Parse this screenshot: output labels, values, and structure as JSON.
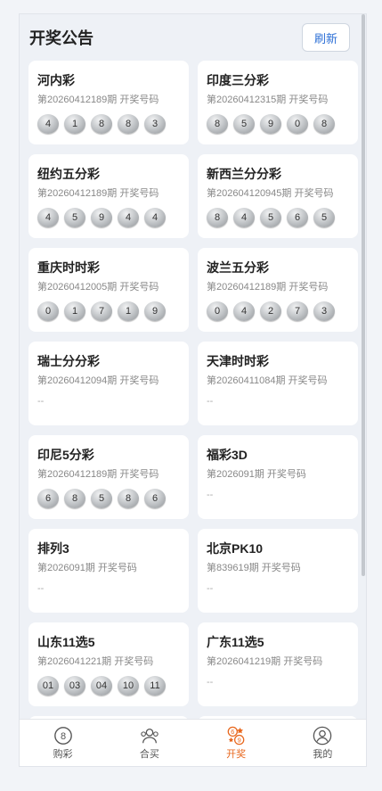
{
  "header": {
    "title": "开奖公告",
    "refresh_label": "刷新"
  },
  "lotteries": [
    {
      "name": "河内彩",
      "issue": "第20260412189期 开奖号码",
      "balls": [
        "4",
        "1",
        "8",
        "8",
        "3"
      ]
    },
    {
      "name": "印度三分彩",
      "issue": "第20260412315期 开奖号码",
      "balls": [
        "8",
        "5",
        "9",
        "0",
        "8"
      ]
    },
    {
      "name": "纽约五分彩",
      "issue": "第20260412189期 开奖号码",
      "balls": [
        "4",
        "5",
        "9",
        "4",
        "4"
      ]
    },
    {
      "name": "新西兰分分彩",
      "issue": "第20260412094​5期 开奖号码",
      "balls": [
        "8",
        "4",
        "5",
        "6",
        "5"
      ]
    },
    {
      "name": "重庆时时彩",
      "issue": "第20260412005期 开奖号码",
      "balls": [
        "0",
        "1",
        "7",
        "1",
        "9"
      ]
    },
    {
      "name": "波兰五分彩",
      "issue": "第20260412189期 开奖号码",
      "balls": [
        "0",
        "4",
        "2",
        "7",
        "3"
      ]
    },
    {
      "name": "瑞士分分彩",
      "issue": "第20260412094期 开奖号码",
      "balls": [],
      "empty": "--"
    },
    {
      "name": "天津时时彩",
      "issue": "第20260411084期 开奖号码",
      "balls": [],
      "empty": "--"
    },
    {
      "name": "印尼5分彩",
      "issue": "第20260412189期 开奖号码",
      "balls": [
        "6",
        "8",
        "5",
        "8",
        "6"
      ]
    },
    {
      "name": "福彩3D",
      "issue": "第2026091期 开奖号码",
      "balls": [],
      "empty": "--"
    },
    {
      "name": "排列3",
      "issue": "第2026091期 开奖号码",
      "balls": [],
      "empty": "--"
    },
    {
      "name": "北京PK10",
      "issue": "第839619期 开奖号码",
      "balls": [],
      "empty": "--"
    },
    {
      "name": "山东11选5",
      "issue": "第2026041221期 开奖号码",
      "balls": [
        "01",
        "03",
        "04",
        "10",
        "11"
      ]
    },
    {
      "name": "广东11选5",
      "issue": "第2026041219期 开奖号码",
      "balls": [],
      "empty": "--"
    },
    {
      "name": "",
      "issue": "",
      "balls": []
    },
    {
      "name": "",
      "issue": "",
      "balls": []
    }
  ],
  "tabs": [
    {
      "label": "购彩",
      "icon": "lottery-ball-icon",
      "active": false
    },
    {
      "label": "合买",
      "icon": "group-icon",
      "active": false
    },
    {
      "label": "开奖",
      "icon": "draw-result-icon",
      "active": true
    },
    {
      "label": "我的",
      "icon": "user-icon",
      "active": false
    }
  ],
  "colors": {
    "accent": "#e8671d",
    "link": "#2c6fd6"
  }
}
